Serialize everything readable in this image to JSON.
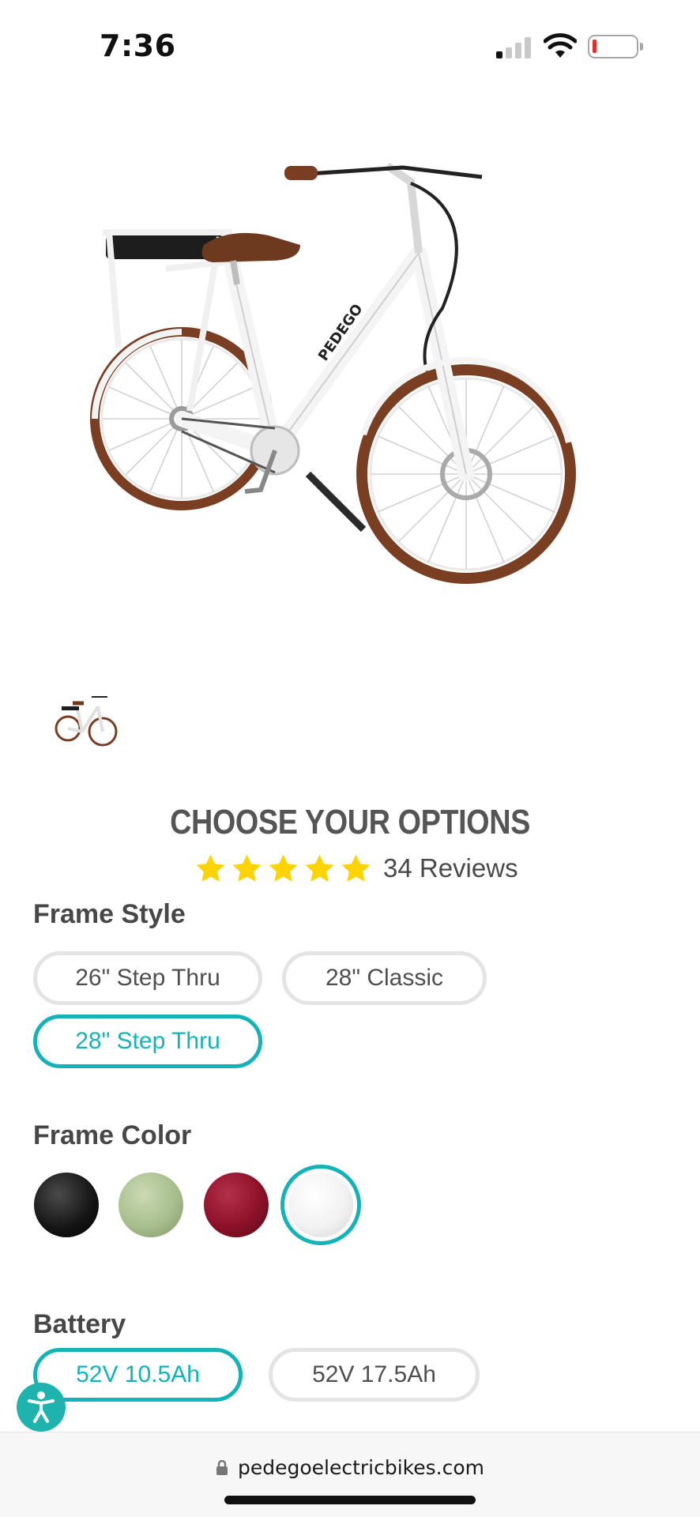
{
  "status_bar": {
    "time": "7:36",
    "signal_icon": "cellular-signal-icon",
    "wifi_icon": "wifi-icon",
    "battery_icon": "battery-low-icon",
    "battery_color": "#e0302a"
  },
  "product": {
    "image": "white-step-thru-ebike",
    "thumbnail": "ebike-thumbnail"
  },
  "options": {
    "title": "CHOOSE YOUR OPTIONS",
    "rating": {
      "stars": 5,
      "max_stars": 5,
      "star_color": "#fdd300",
      "reviews_label": "34 Reviews"
    },
    "frame_style": {
      "label": "Frame Style",
      "choices": [
        "26\" Step Thru",
        "28\" Classic",
        "28\" Step Thru"
      ],
      "selected": "28\" Step Thru"
    },
    "frame_color": {
      "label": "Frame Color",
      "swatches": [
        {
          "name": "black",
          "color": "#151515"
        },
        {
          "name": "sage-green",
          "color": "#a8be8c"
        },
        {
          "name": "burgundy",
          "color": "#8c1128"
        },
        {
          "name": "white",
          "color": "#f2f2f2"
        }
      ],
      "selected": "white"
    },
    "battery": {
      "label": "Battery",
      "choices": [
        "52V 10.5Ah",
        "52V 17.5Ah"
      ],
      "selected": "52V 10.5Ah"
    }
  },
  "accent_color": "#15b3b8",
  "accessibility_icon": "accessibility-icon",
  "browser": {
    "url": "pedegoelectricbikes.com",
    "lock_icon": "lock-icon"
  }
}
